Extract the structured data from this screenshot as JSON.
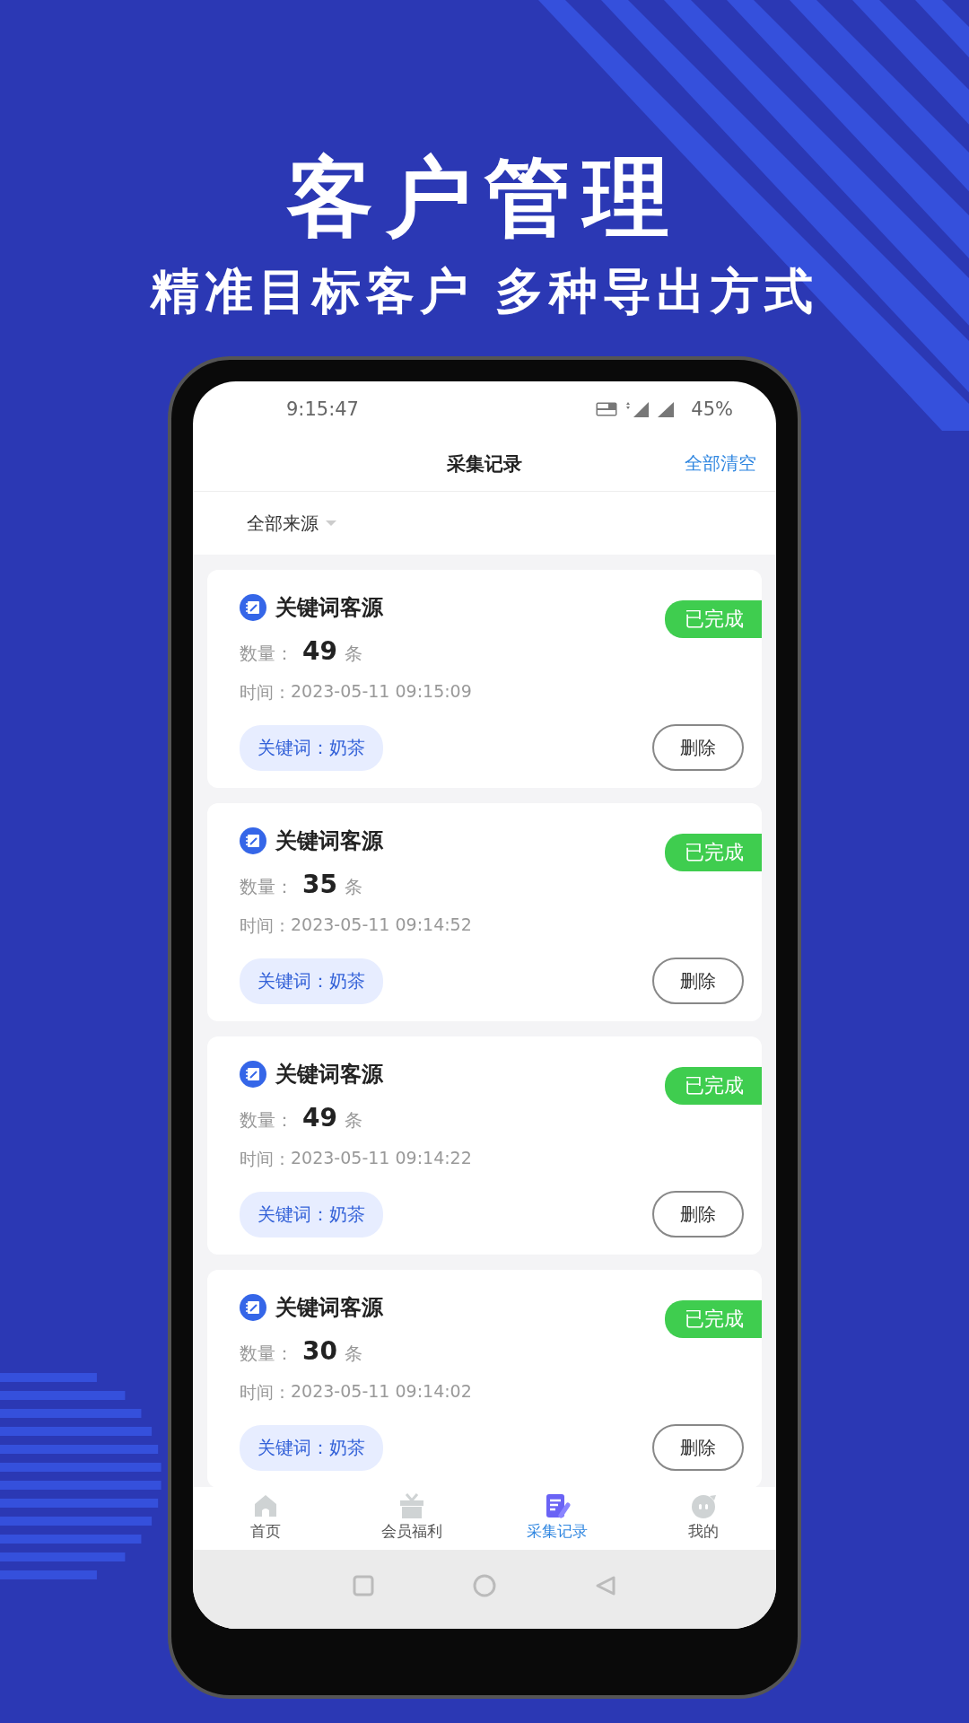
{
  "headline": {
    "title": "客户管理",
    "subtitle": "精准目标客户 多种导出方式"
  },
  "status_bar": {
    "time": "9:15:47",
    "battery": "45%"
  },
  "nav_bar": {
    "title": "采集记录",
    "action": "全部清空"
  },
  "filter": {
    "label": "全部来源"
  },
  "records": [
    {
      "name": "关键词客源",
      "status": "已完成",
      "quantity_label": "数量：",
      "quantity": "49",
      "unit": "条",
      "time_label": "时间：",
      "time": "2023-05-11 09:15:09",
      "keyword": "关键词：奶茶",
      "delete": "删除"
    },
    {
      "name": "关键词客源",
      "status": "已完成",
      "quantity_label": "数量：",
      "quantity": "35",
      "unit": "条",
      "time_label": "时间：",
      "time": "2023-05-11 09:14:52",
      "keyword": "关键词：奶茶",
      "delete": "删除"
    },
    {
      "name": "关键词客源",
      "status": "已完成",
      "quantity_label": "数量：",
      "quantity": "49",
      "unit": "条",
      "time_label": "时间：",
      "time": "2023-05-11 09:14:22",
      "keyword": "关键词：奶茶",
      "delete": "删除"
    },
    {
      "name": "关键词客源",
      "status": "已完成",
      "quantity_label": "数量：",
      "quantity": "30",
      "unit": "条",
      "time_label": "时间：",
      "time": "2023-05-11 09:14:02",
      "keyword": "关键词：奶茶",
      "delete": "删除"
    }
  ],
  "tabs": [
    {
      "label": "首页",
      "kind": "home",
      "selected": false
    },
    {
      "label": "会员福利",
      "kind": "gift",
      "selected": false
    },
    {
      "label": "采集记录",
      "kind": "records",
      "selected": true
    },
    {
      "label": "我的",
      "kind": "profile",
      "selected": false
    }
  ]
}
